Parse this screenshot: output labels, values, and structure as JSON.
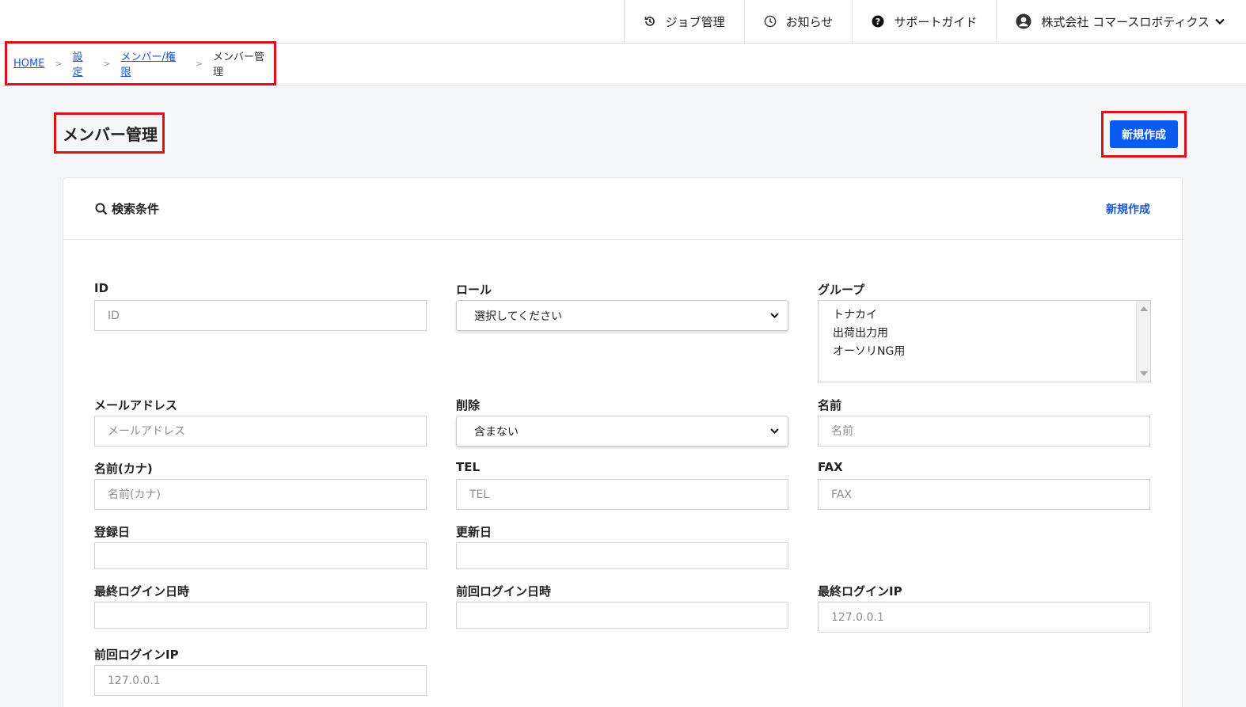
{
  "topnav": {
    "job": "ジョブ管理",
    "news": "お知らせ",
    "support": "サポートガイド",
    "account": "株式会社 コマースロボティクス"
  },
  "breadcrumb": {
    "home": "HOME",
    "settings": "設定",
    "members_roles": "メンバー/権限",
    "current": "メンバー管理",
    "separator": ">"
  },
  "page": {
    "title": "メンバー管理",
    "new_button": "新規作成"
  },
  "search": {
    "title": "検索条件",
    "new_link": "新規作成",
    "fields": {
      "id": {
        "label": "ID",
        "placeholder": "ID"
      },
      "role": {
        "label": "ロール",
        "value": "選択してください"
      },
      "group": {
        "label": "グループ",
        "options": [
          "トナカイ",
          "出荷出力用",
          "オーソリNG用"
        ]
      },
      "email": {
        "label": "メールアドレス",
        "placeholder": "メールアドレス"
      },
      "deleted": {
        "label": "削除",
        "value": "含まない"
      },
      "name": {
        "label": "名前",
        "placeholder": "名前"
      },
      "name_kana": {
        "label": "名前(カナ)",
        "placeholder": "名前(カナ)"
      },
      "tel": {
        "label": "TEL",
        "placeholder": "TEL"
      },
      "fax": {
        "label": "FAX",
        "placeholder": "FAX"
      },
      "created": {
        "label": "登録日"
      },
      "updated": {
        "label": "更新日"
      },
      "last_login": {
        "label": "最終ログイン日時"
      },
      "prev_login": {
        "label": "前回ログイン日時"
      },
      "last_login_ip": {
        "label": "最終ログインIP",
        "placeholder": "127.0.0.1"
      },
      "prev_login_ip": {
        "label": "前回ログインIP",
        "placeholder": "127.0.0.1"
      }
    }
  },
  "colors": {
    "accent": "#0b5bf0",
    "link": "#1a56d6",
    "highlight": "#e0101a"
  }
}
